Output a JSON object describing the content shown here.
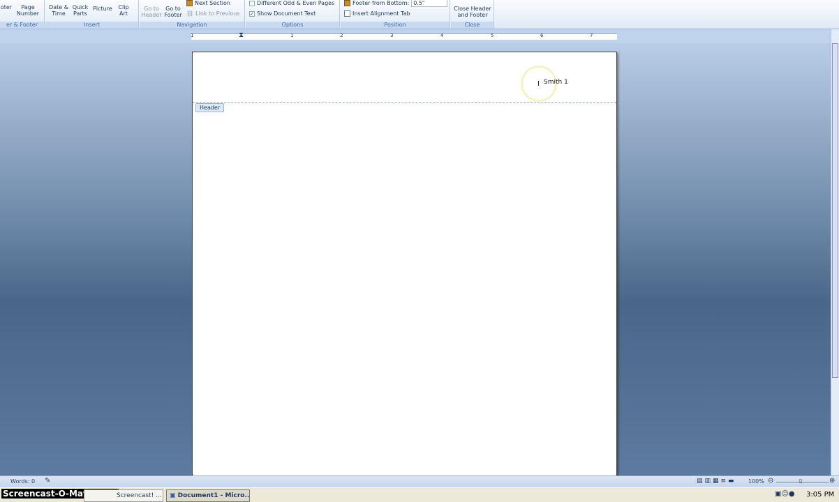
{
  "ribbon": {
    "groups": {
      "header_footer": "er & Footer",
      "insert": "Insert",
      "navigation": "Navigation",
      "options": "Options",
      "position": "Position",
      "close": "Close"
    },
    "footer_btn": "oter",
    "page_number": "Page Number",
    "date_time": "Date & Time",
    "quick_parts": "Quick Parts",
    "picture": "Picture",
    "clip_art": "Clip Art",
    "go_to_header": "Go to Header",
    "go_to_footer": "Go to Footer",
    "next_section": "Next Section",
    "link_to_previous": "Link to Previous",
    "different_odd_even": "Different Odd & Even Pages",
    "show_document_text": "Show Document Text",
    "show_document_text_checked": true,
    "different_odd_even_checked": false,
    "footer_from_bottom_label": "Footer from Bottom:",
    "footer_from_bottom_value": "0.5\"",
    "insert_alignment_tab": "Insert Alignment Tab",
    "close_header_footer": "Close Header and Footer"
  },
  "ruler": {
    "numbers": [
      "1",
      "1",
      "2",
      "3",
      "4",
      "5",
      "6",
      "7"
    ]
  },
  "document": {
    "header_tab": "Header",
    "header_text": "Smith 1"
  },
  "status": {
    "words": "Words: 0",
    "zoom": "100%"
  },
  "taskbar": {
    "watermark": "Screencast-O-Matic.com",
    "task1": "Screencast! ...",
    "task2": "Document1 - Micro...",
    "clock": "3:05 PM"
  }
}
